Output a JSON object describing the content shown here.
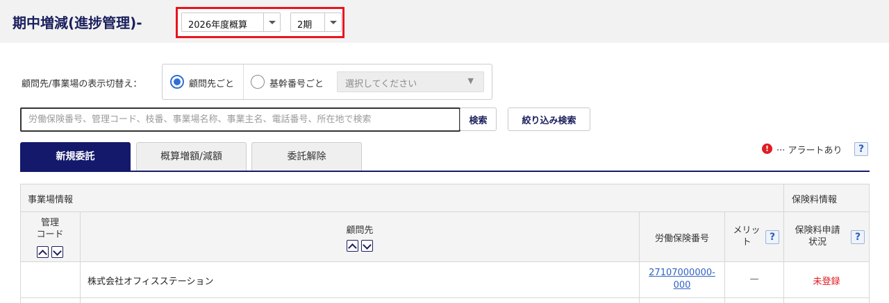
{
  "header": {
    "title": "期中増減(進捗管理)-",
    "year_select": "2026年度概算",
    "period_select": "2期"
  },
  "display_toggle": {
    "label": "顧問先/事業場の表示切替え：",
    "options": [
      {
        "label": "顧問先ごと",
        "selected": true
      },
      {
        "label": "基幹番号ごと",
        "selected": false
      }
    ],
    "select_placeholder": "選択してください"
  },
  "search": {
    "placeholder": "労働保険番号、管理コード、枝番、事業場名称、事業主名、電話番号、所在地で検索",
    "search_button": "検索",
    "filter_button": "絞り込み検索"
  },
  "tabs": [
    {
      "label": "新規委託",
      "active": true
    },
    {
      "label": "概算増額/減額",
      "active": false
    },
    {
      "label": "委託解除",
      "active": false
    }
  ],
  "alert_legend": {
    "icon": "!",
    "text": "··· アラートあり",
    "help": "?"
  },
  "table": {
    "group_headers": {
      "office_info": "事業場情報",
      "premium_info": "保険料情報"
    },
    "columns": {
      "code": "管理\nコード",
      "client": "顧問先",
      "insurance_no": "労働保険番号",
      "merit": "メリッ\nト",
      "application_status": "保険料申請\n状況",
      "help": "?"
    },
    "rows": [
      {
        "code": "",
        "client": "株式会社オフィスステーション",
        "insurance_no": "27107000000-000",
        "insurance_no_line1": "27107000000-",
        "insurance_no_line2": "000",
        "merit": "—",
        "status": "未登録"
      }
    ]
  },
  "colors": {
    "brand_navy": "#14196b",
    "highlight_red": "#e8141e",
    "status_red": "#e01c24",
    "link_blue": "#2f62c4"
  }
}
